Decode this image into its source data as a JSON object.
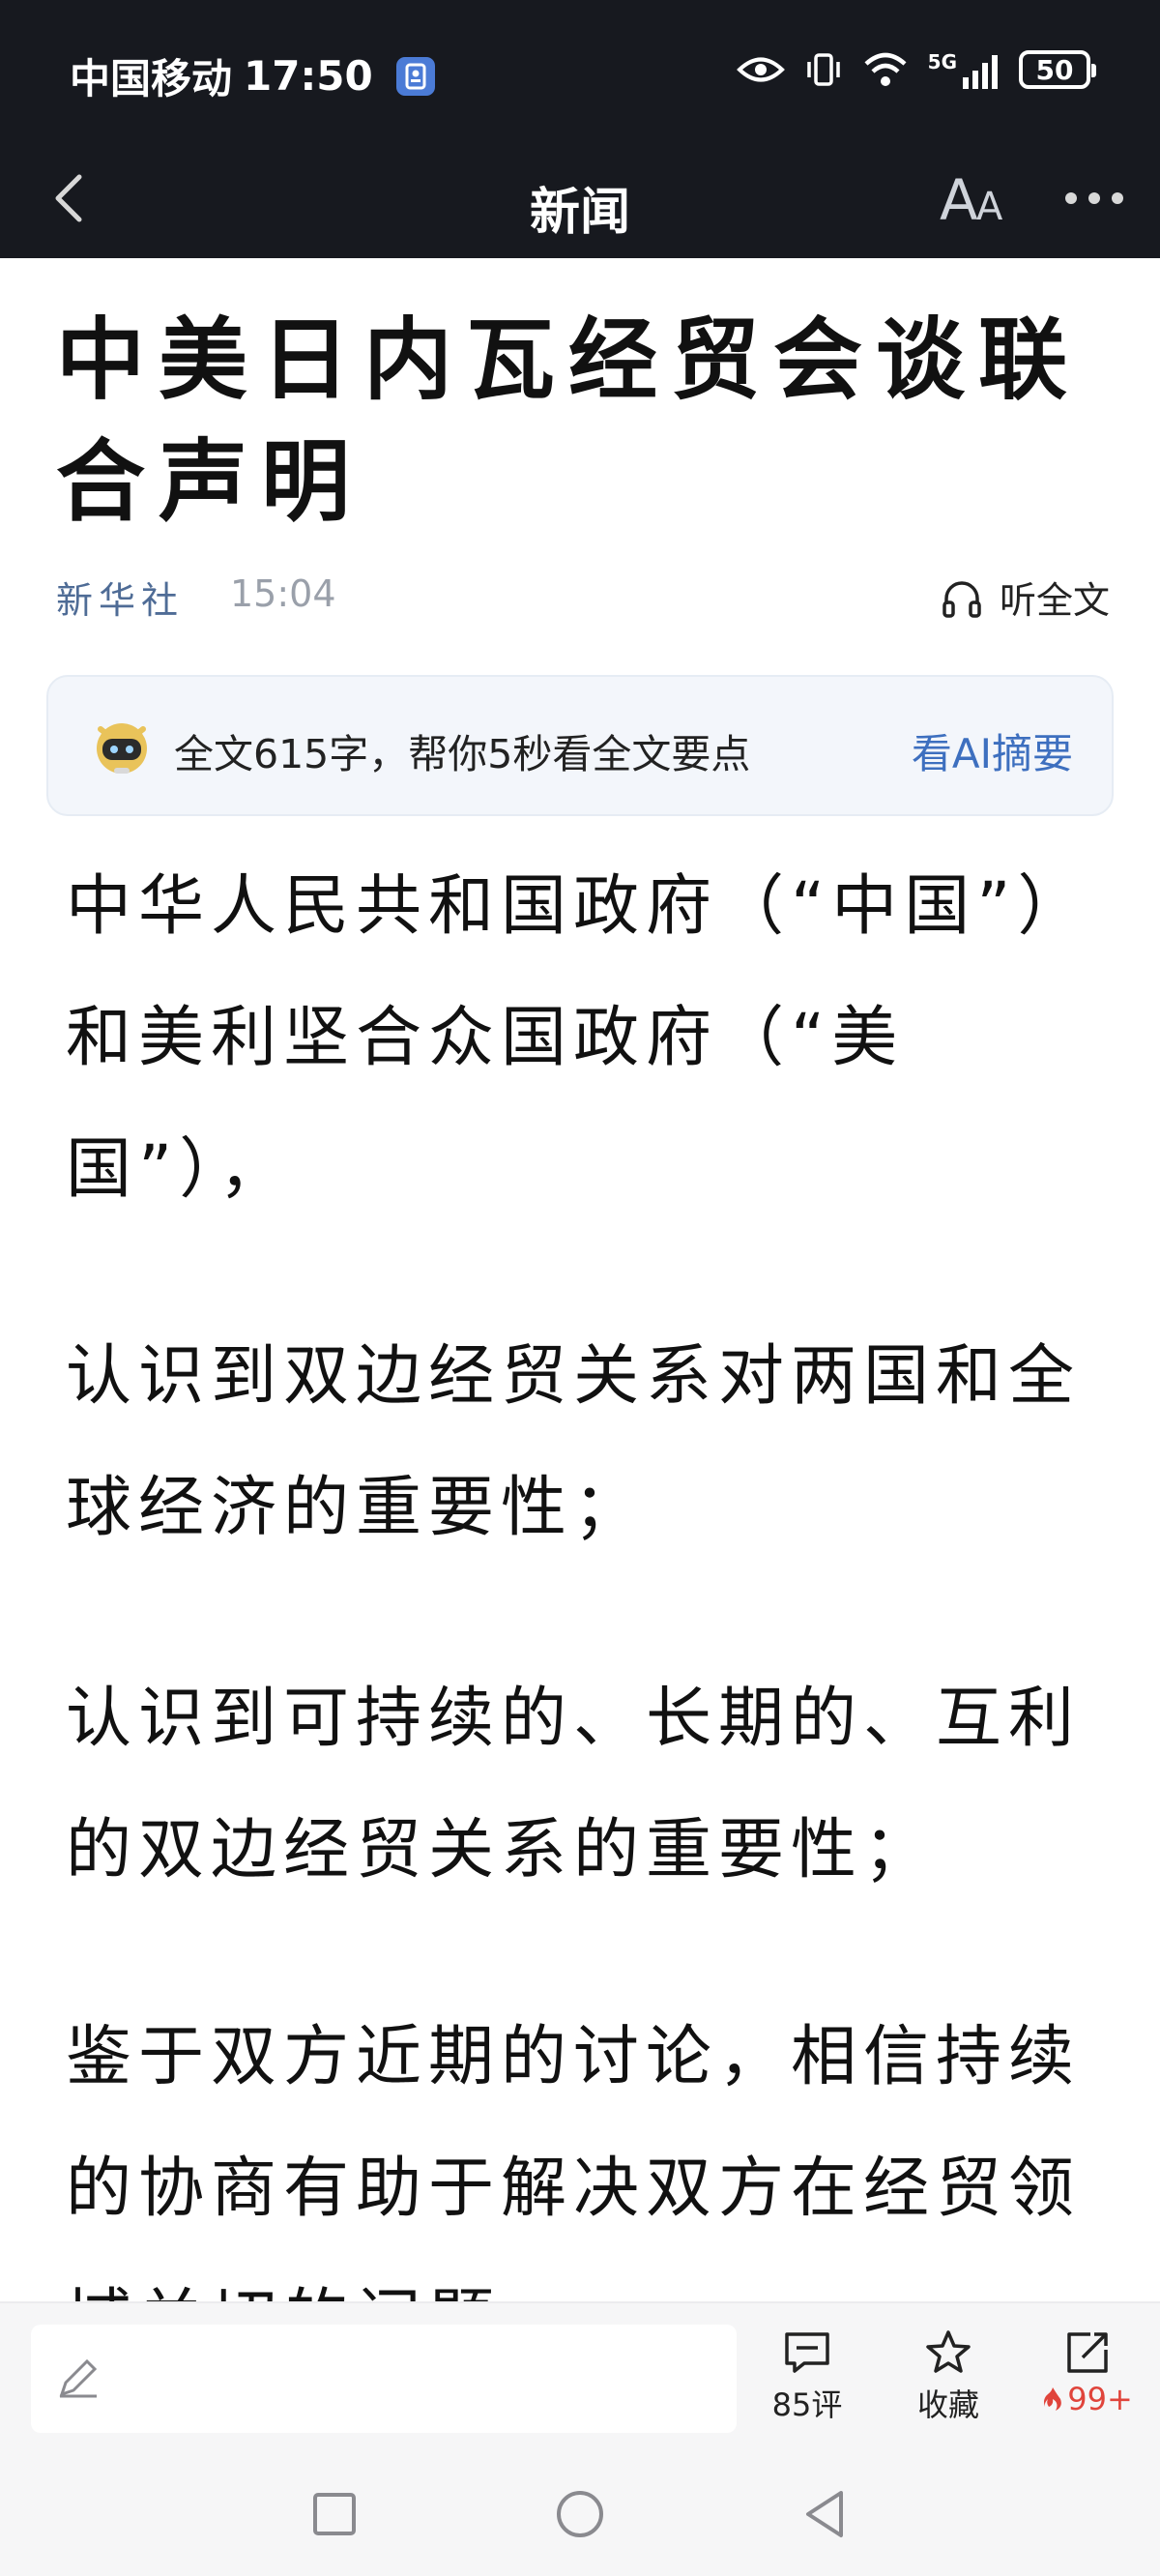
{
  "status_bar": {
    "carrier": "中国移动",
    "time": "17:50",
    "network": "5G",
    "battery": "50"
  },
  "nav": {
    "title": "新闻"
  },
  "article": {
    "title": "中美日内瓦经贸会谈联合声明",
    "source": "新华社",
    "time": "15:04",
    "listen_label": "听全文"
  },
  "ai_summary": {
    "text": "全文615字，帮你5秒看全文要点",
    "link": "看AI摘要"
  },
  "paragraphs": [
    "中华人民共和国政府（“中国”）和美利坚合众国政府（“美国”），",
    "认识到双边经贸关系对两国和全球经济的重要性；",
    "认识到可持续的、长期的、互利的双边经贸关系的重要性；",
    "鉴于双方近期的讨论，相信持续的协商有助于解决双方在经贸领域关切的问题，"
  ],
  "toolbar": {
    "comment_count": "85评",
    "favorite_label": "收藏",
    "share_count": "99+"
  },
  "icons": {
    "back": "chevron-left-icon",
    "font_size": "font-size-icon",
    "more": "more-icon",
    "headphones": "headphones-icon",
    "robot": "ai-robot-icon",
    "pencil": "pencil-icon",
    "comment": "comment-icon",
    "star": "star-icon",
    "share": "share-icon",
    "fire": "fire-icon"
  },
  "colors": {
    "header_bg": "#17191f",
    "source": "#4f6c96",
    "ai_link": "#3d6fbf",
    "hot": "#e0443b"
  }
}
